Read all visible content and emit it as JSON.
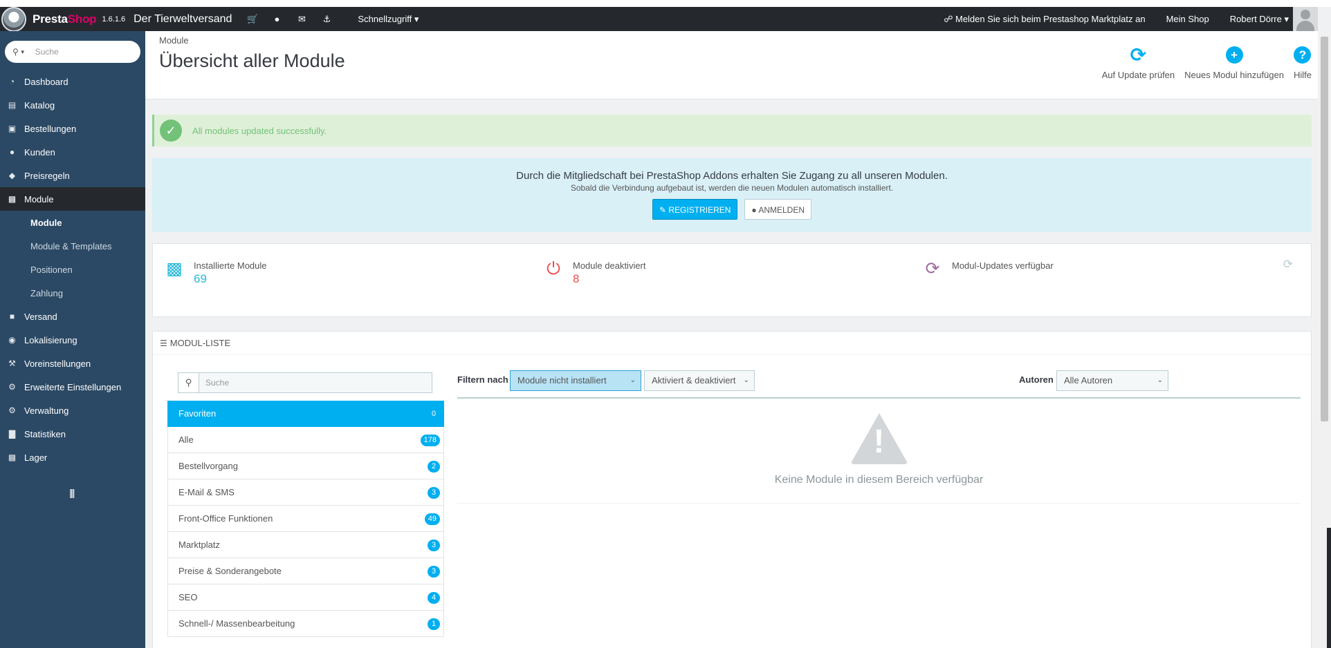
{
  "header": {
    "brand_part1": "Presta",
    "brand_part2": "Shop",
    "version": "1.6.1.6",
    "shop_name": "Der Tierweltversand",
    "quick_access": "Schnellzugriff",
    "addons_login": "Melden Sie sich beim Prestashop Marktplatz an",
    "my_shop": "Mein Shop",
    "user": "Robert Dörre"
  },
  "sidebar": {
    "search_placeholder": "Suche",
    "items": [
      {
        "label": "Dashboard",
        "icon": "dashboard-icon"
      },
      {
        "label": "Katalog",
        "icon": "book-icon"
      },
      {
        "label": "Bestellungen",
        "icon": "credit-card-icon"
      },
      {
        "label": "Kunden",
        "icon": "users-icon"
      },
      {
        "label": "Preisregeln",
        "icon": "tags-icon"
      },
      {
        "label": "Module",
        "icon": "puzzle-icon"
      },
      {
        "label": "Versand",
        "icon": "truck-icon"
      },
      {
        "label": "Lokalisierung",
        "icon": "globe-icon"
      },
      {
        "label": "Voreinstellungen",
        "icon": "wrench-icon"
      },
      {
        "label": "Erweiterte Einstellungen",
        "icon": "cogs-icon"
      },
      {
        "label": "Verwaltung",
        "icon": "cog-icon"
      },
      {
        "label": "Statistiken",
        "icon": "bar-chart-icon"
      },
      {
        "label": "Lager",
        "icon": "archive-icon"
      }
    ],
    "submenu": [
      "Module",
      "Module & Templates",
      "Positionen",
      "Zahlung"
    ]
  },
  "page": {
    "breadcrumb": "Module",
    "title": "Übersicht aller Module",
    "toolbar": {
      "check_update": "Auf Update prüfen",
      "add_module": "Neues Modul hinzufügen",
      "help": "Hilfe"
    }
  },
  "alert": {
    "message": "All modules updated successfully."
  },
  "addons": {
    "line1": "Durch die Mitgliedschaft bei PrestaShop Addons erhalten Sie Zugang zu all unseren Modulen.",
    "line2": "Sobald die Verbindung aufgebaut ist, werden die neuen Modulen automatisch installiert.",
    "register": "REGISTRIEREN",
    "login": "ANMELDEN"
  },
  "stats": {
    "installed_label": "Installierte Module",
    "installed_value": "69",
    "disabled_label": "Module deaktiviert",
    "disabled_value": "8",
    "updates_label": "Modul-Updates verfügbar",
    "colors": {
      "installed": "#25b9d7",
      "disabled": "#e84e4e",
      "updates": "#a06b9e"
    }
  },
  "module_list": {
    "heading": "MODUL-LISTE",
    "search_placeholder": "Suche",
    "categories": [
      {
        "label": "Favoriten",
        "count": "0"
      },
      {
        "label": "Alle",
        "count": "178"
      },
      {
        "label": "Bestellvorgang",
        "count": "2"
      },
      {
        "label": "E-Mail & SMS",
        "count": "3"
      },
      {
        "label": "Front-Office Funktionen",
        "count": "49"
      },
      {
        "label": "Marktplatz",
        "count": "3"
      },
      {
        "label": "Preise & Sonderangebote",
        "count": "3"
      },
      {
        "label": "SEO",
        "count": "4"
      },
      {
        "label": "Schnell-/ Massenbearbeitung",
        "count": "1"
      }
    ],
    "filter_label": "Filtern nach",
    "filter_install": "Module nicht installiert",
    "filter_status": "Aktiviert & deaktiviert",
    "authors_label": "Autoren",
    "authors_value": "Alle Autoren",
    "empty_message": "Keine Module in diesem Bereich verfügbar"
  }
}
